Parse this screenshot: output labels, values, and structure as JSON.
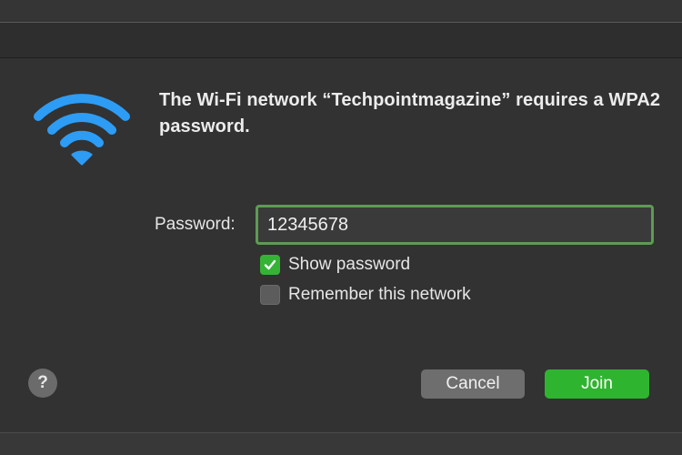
{
  "dialog": {
    "message": "The Wi-Fi network “Techpointmagazine” requires a WPA2 password.",
    "password_label": "Password:",
    "password_value": "12345678",
    "show_password": {
      "label": "Show password",
      "checked": true
    },
    "remember_network": {
      "label": "Remember this network",
      "checked": false
    },
    "help_label": "?",
    "cancel_label": "Cancel",
    "join_label": "Join"
  },
  "icons": {
    "wifi": "wifi-icon",
    "check": "checkmark-icon",
    "help": "question-mark-icon"
  },
  "colors": {
    "wifi_blue": "#2d9cf5",
    "focus_ring": "#5f9a55",
    "checkbox_checked": "#35b335",
    "join_button": "#2fb42f",
    "cancel_button": "#6e6e6e",
    "dialog_background": "#323232"
  }
}
